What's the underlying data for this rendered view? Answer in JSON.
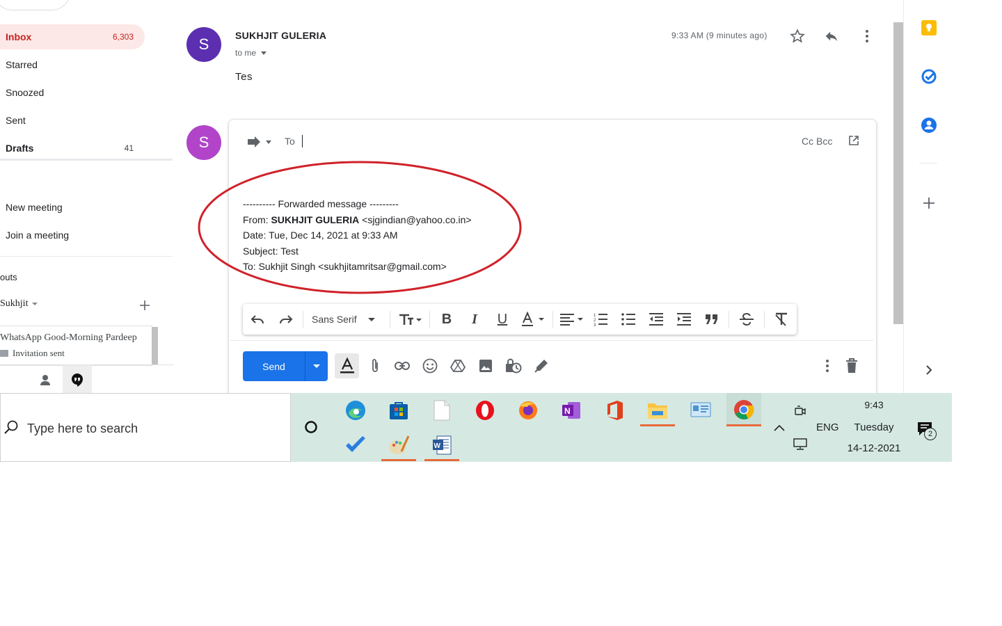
{
  "nav": {
    "items": [
      {
        "label": "Inbox",
        "count": "6,303"
      },
      {
        "label": "Starred",
        "count": ""
      },
      {
        "label": "Snoozed",
        "count": ""
      },
      {
        "label": "Sent",
        "count": ""
      },
      {
        "label": "Drafts",
        "count": "41"
      }
    ],
    "meet": [
      "New meeting",
      "Join a meeting"
    ],
    "hangouts_heading": "outs",
    "hangouts_user": "Sukhjit",
    "hangout_conv": {
      "title": "WhatsApp Good-Morning Pardeep",
      "status": "Invitation sent"
    }
  },
  "message": {
    "avatar_letter": "S",
    "sender": "SUKHJIT GULERIA",
    "recipient": "to me",
    "time": "9:33 AM (9 minutes ago)",
    "body": "Tes"
  },
  "compose": {
    "avatar_letter": "S",
    "to_label": "To",
    "cc_bcc": "Cc Bcc",
    "forward": {
      "header": "---------- Forwarded message ---------",
      "from_label": "From: ",
      "from_name": "SUKHJIT GULERIA",
      "from_email": " <sjgindian@yahoo.co.in>",
      "date": "Date: Tue, Dec 14, 2021 at 9:33 AM",
      "subject": "Subject: Test",
      "to": "To: Sukhjit Singh <sukhjitamritsar@gmail.com>"
    },
    "font": "Sans Serif",
    "send_label": "Send"
  },
  "taskbar": {
    "search_placeholder": "Type here to search",
    "lang": "ENG",
    "time": "9:43",
    "day": "Tuesday",
    "date": "14-12-2021",
    "notif_count": "2"
  },
  "colors": {
    "inbox_bg": "#fce8e6",
    "inbox_fg": "#c5221f",
    "avatar1": "#5b2fb0",
    "avatar2": "#b144c9",
    "send": "#1a73e8",
    "annotation": "#d0212a",
    "taskbar": "#d5e9e2"
  }
}
